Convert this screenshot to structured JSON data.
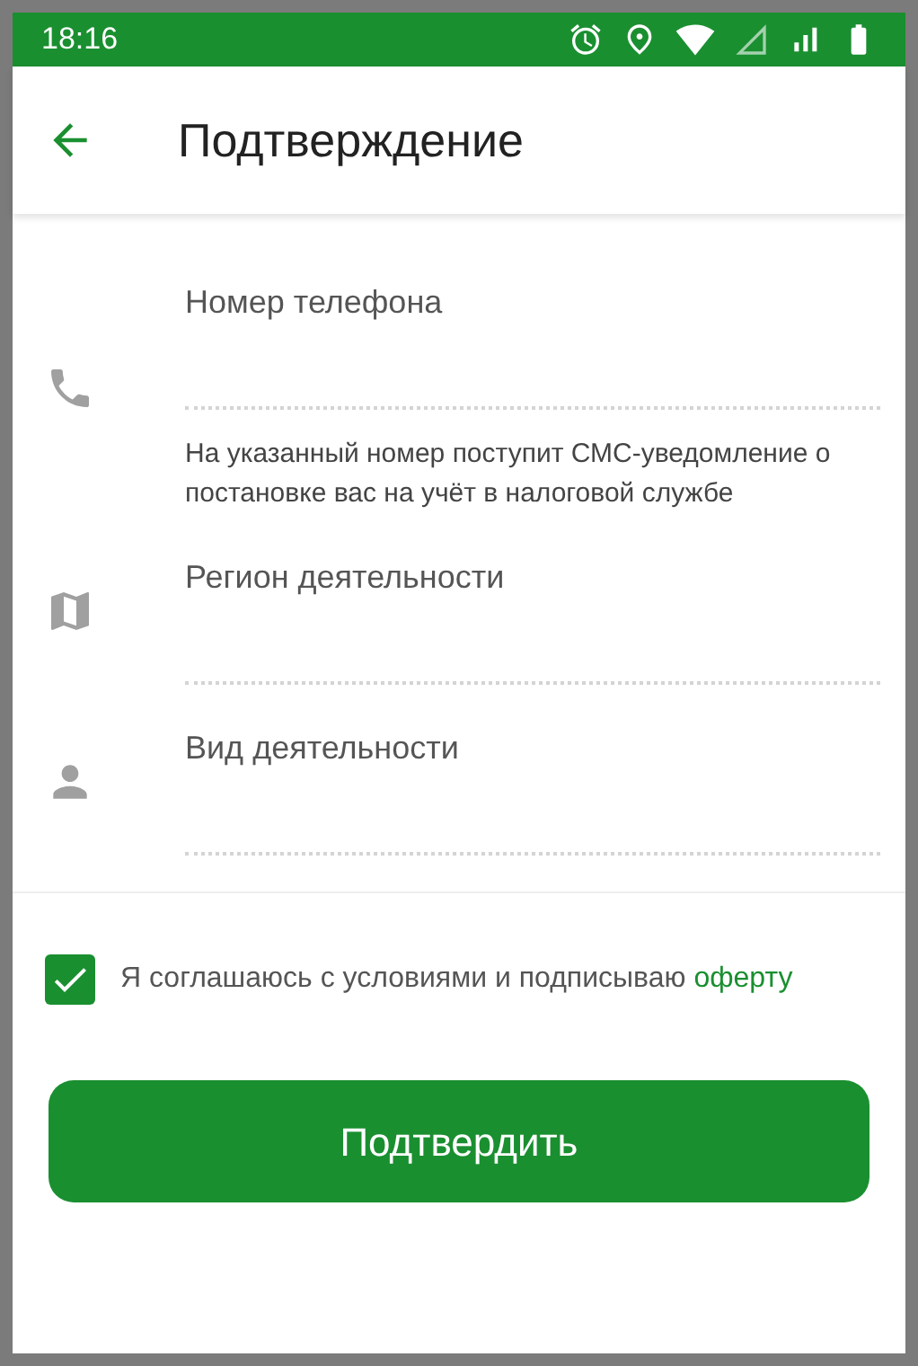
{
  "status_bar": {
    "time": "18:16"
  },
  "header": {
    "title": "Подтверждение"
  },
  "fields": [
    {
      "kind": "phone",
      "label": "Номер телефона",
      "hint": "На указанный номер поступит СМС-уведомление о постановке вас на учёт в налоговой службе"
    },
    {
      "kind": "map",
      "label": "Регион деятельности"
    },
    {
      "kind": "person",
      "label": "Вид деятельности"
    }
  ],
  "agreement": {
    "checked": true,
    "text": "Я соглашаюсь с условиями и подписываю",
    "link": "оферту"
  },
  "confirm_button": {
    "label": "Подтвердить"
  }
}
